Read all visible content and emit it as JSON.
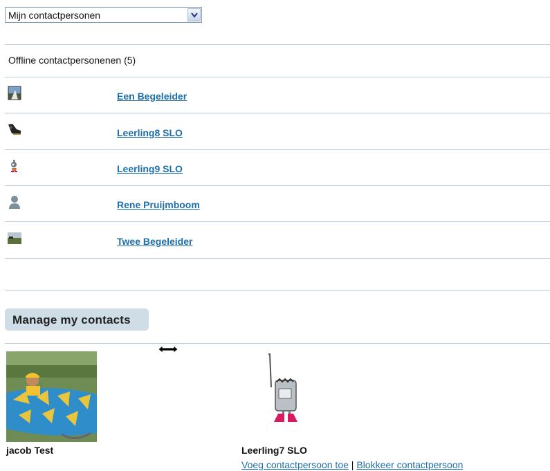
{
  "contacts_select": {
    "selected": "Mijn contactpersonen"
  },
  "offline_section": {
    "title": "Offline contactpersonenen (5)",
    "contacts": [
      {
        "name": "Een Begeleider",
        "icon": "landscape-avatar-icon"
      },
      {
        "name": "Leerling8 SLO",
        "icon": "shoe-avatar-icon"
      },
      {
        "name": "Leerling9 SLO",
        "icon": "robot-avatar-icon"
      },
      {
        "name": "Rene Pruijmboom",
        "icon": "default-user-avatar-icon"
      },
      {
        "name": "Twee Begeleider",
        "icon": "field-avatar-icon"
      }
    ]
  },
  "manage": {
    "button_label": "Manage my contacts"
  },
  "cards": [
    {
      "name": "jacob Test",
      "image": "kayak-photo"
    },
    {
      "name": "Leerling7 SLO",
      "image": "robot-figure-image"
    }
  ],
  "card_actions": {
    "add": "Voeg contactpersoon toe",
    "separator": "|",
    "block": "Blokkeer contactpersoon"
  },
  "colors": {
    "link": "#1e6fa8",
    "rule": "#b7cad6",
    "button_bg": "#cfdde6"
  }
}
